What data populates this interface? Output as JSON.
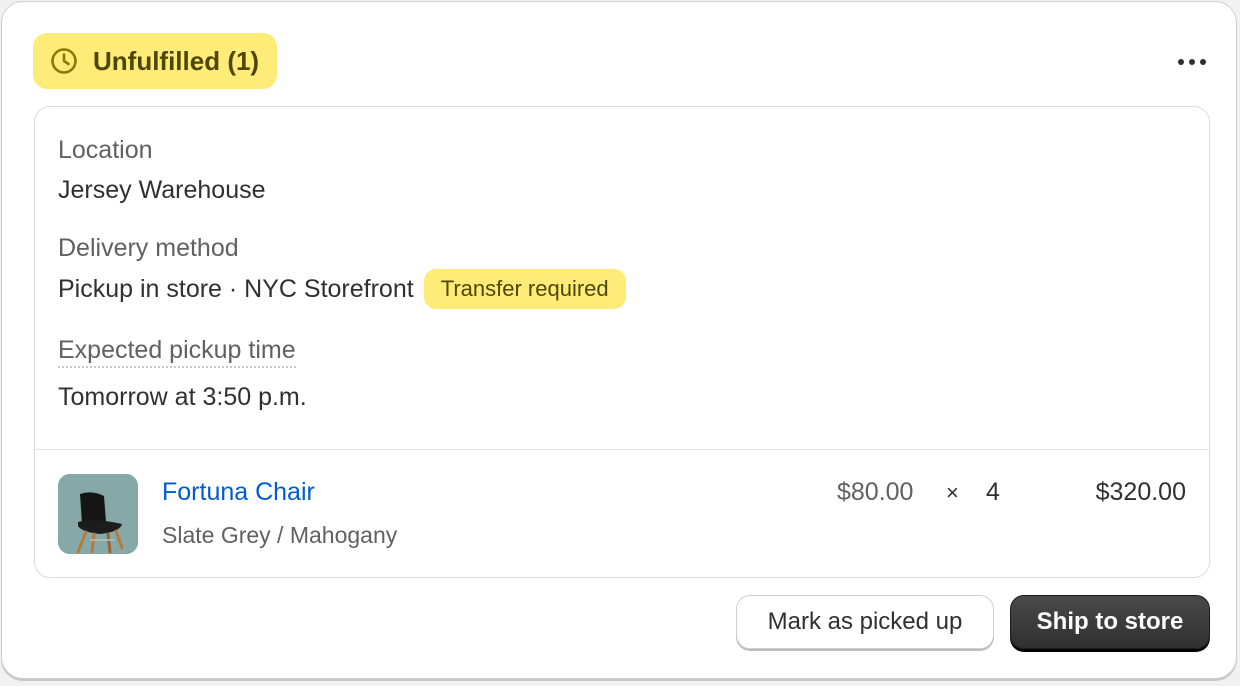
{
  "status": {
    "label": "Unfulfilled (1)",
    "icon": "clock-icon",
    "color": "#ffeb78"
  },
  "menu": {
    "icon": "more-horizontal-icon"
  },
  "location": {
    "label": "Location",
    "value": "Jersey Warehouse"
  },
  "delivery": {
    "label": "Delivery method",
    "value": "Pickup in store · NYC Storefront",
    "badge": "Transfer required"
  },
  "pickup": {
    "label": "Expected pickup time",
    "value": "Tomorrow at 3:50 p.m."
  },
  "line_item": {
    "title": "Fortuna Chair",
    "variant": "Slate Grey / Mahogany",
    "unit_price": "$80.00",
    "times": "×",
    "quantity": "4",
    "total": "$320.00",
    "link_color": "#005bd3"
  },
  "actions": {
    "secondary_label": "Mark as picked up",
    "primary_label": "Ship to store"
  }
}
